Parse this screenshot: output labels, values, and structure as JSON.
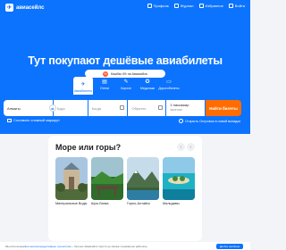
{
  "brand": {
    "name": "авиасейлс"
  },
  "nav": {
    "items": [
      {
        "label": "Профиль",
        "icon": "profile-icon"
      },
      {
        "label": "Журнал",
        "icon": "journal-icon"
      },
      {
        "label": "Избранное",
        "icon": "heart-icon"
      },
      {
        "label": "Войти",
        "icon": "login-icon"
      }
    ]
  },
  "hero": {
    "title": "Тут покупают дешёвые авиабилеты",
    "cashback": "Кэшбэк 4% на Авиасейлс",
    "categories": [
      {
        "label": "Авиабилеты",
        "icon": "plane-icon",
        "active": true
      },
      {
        "label": "Отели",
        "icon": "hotel-icon",
        "active": false
      },
      {
        "label": "Короче",
        "icon": "short-icon",
        "active": false
      },
      {
        "label": "Медальки",
        "icon": "medal-icon",
        "active": false
      },
      {
        "label": "Дорогобилеты",
        "icon": "ticket-icon",
        "active": false
      }
    ]
  },
  "search": {
    "from_value": "Алматы",
    "to_placeholder": "Куда",
    "when_placeholder": "Когда",
    "back_placeholder": "Обратно",
    "passengers_line1": "1 пассажир",
    "passengers_line2": "эконом",
    "find_label": "Найти билеты",
    "compose_label": "Составить сложный маршрут",
    "booking_label": "Открыть Островок в новой вкладке"
  },
  "promo": {
    "title": "Море или горы?",
    "destinations": [
      {
        "name": "Минеральные Воды"
      },
      {
        "name": "Шри-Ланка"
      },
      {
        "name": "Горно-Алтайск"
      },
      {
        "name": "Мальдивы"
      }
    ]
  },
  "cookie": {
    "prefix": "Мы используем ",
    "link": "все высокопродуктивные технологии",
    "suffix": " — без них Авиасейлс просто не сможет нормально работать.",
    "button": "Да без проблем"
  },
  "colors": {
    "brand_blue": "#0c73fe",
    "cta_orange": "#ff6d00"
  }
}
